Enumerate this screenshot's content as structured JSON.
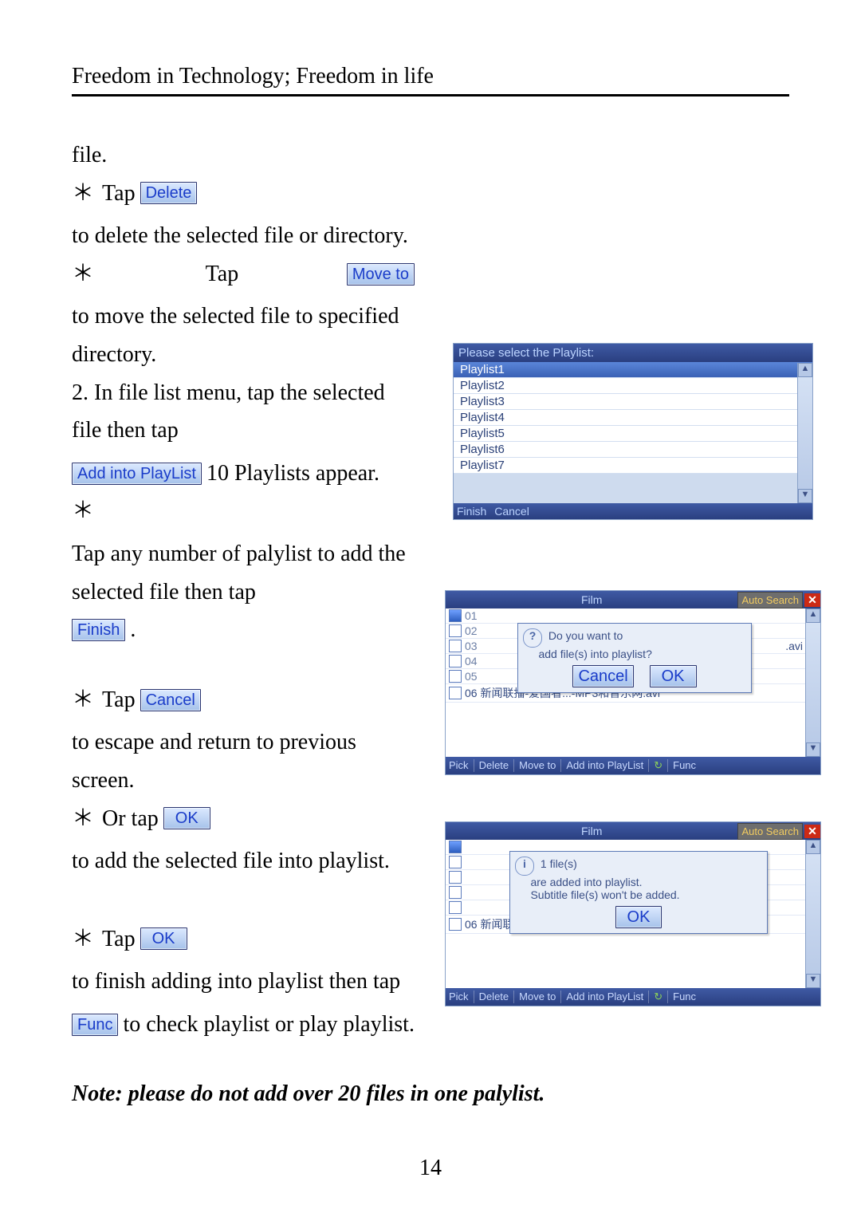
{
  "header": {
    "running": "Freedom in Technology; Freedom in life"
  },
  "pagenum": "14",
  "buttons": {
    "delete": "Delete",
    "moveto": "Move to",
    "addPlaylist": "Add into PlayList",
    "finish": "Finish",
    "cancel": "Cancel",
    "ok": "OK",
    "func": "Func"
  },
  "text": {
    "line_file": "file.",
    "p_del_a": "Tap ",
    "p_del_b": " to delete the selected file or directory.",
    "p_move_a": "Tap ",
    "p_move_b": " to move the selected file to specified directory.",
    "p_list": "2. In file list menu, tap the selected file then tap ",
    "p_list_b": " 10 Playlists appear.",
    "p_any": "Tap any number of palylist to add the selected file then tap ",
    "p_any_b": " .",
    "p_cancel_a": "Tap ",
    "p_cancel_b": " to escape and return to previous screen.",
    "p_or_a": "Or tap ",
    "p_or_b": " to add the selected  file into playlist.",
    "p_fin_a": "Tap ",
    "p_fin_b": " to finish adding into playlist then tap ",
    "p_fin_c": " to check playlist or play playlist.",
    "note": "Note: please do not add over 20 files in one palylist."
  },
  "shot1": {
    "title": "Please select the Playlist:",
    "items": [
      "Playlist1",
      "Playlist2",
      "Playlist3",
      "Playlist4",
      "Playlist5",
      "Playlist6",
      "Playlist7"
    ],
    "foot_finish": "Finish",
    "foot_cancel": "Cancel"
  },
  "shot2": {
    "title": "Film",
    "auto": "Auto Search",
    "dialog_line1": "Do you want to",
    "dialog_line2": "add file(s) into playlist?",
    "dlg_cancel": "Cancel",
    "dlg_ok": "OK",
    "row_ext": ".avi",
    "rows": [
      "01",
      "02",
      "03",
      "04",
      "05"
    ],
    "row6": "06 新闻联播-爱国者...-MP3和音乐网.avi",
    "toolbar": [
      "Pick",
      "Delete",
      "Move to",
      "Add into PlayList",
      "↻",
      "Func"
    ]
  },
  "shot3": {
    "title": "Film",
    "auto": "Auto Search",
    "msg_l1": "1  file(s)",
    "msg_l2": "are added into playlist.",
    "msg_l3": "Subtitle file(s) won't be added.",
    "dlg_ok": "OK",
    "row6": "06 新闻联播-爱国者...-MP3和音乐网.avi",
    "toolbar": [
      "Pick",
      "Delete",
      "Move to",
      "Add into PlayList",
      "↻",
      "Func"
    ]
  }
}
